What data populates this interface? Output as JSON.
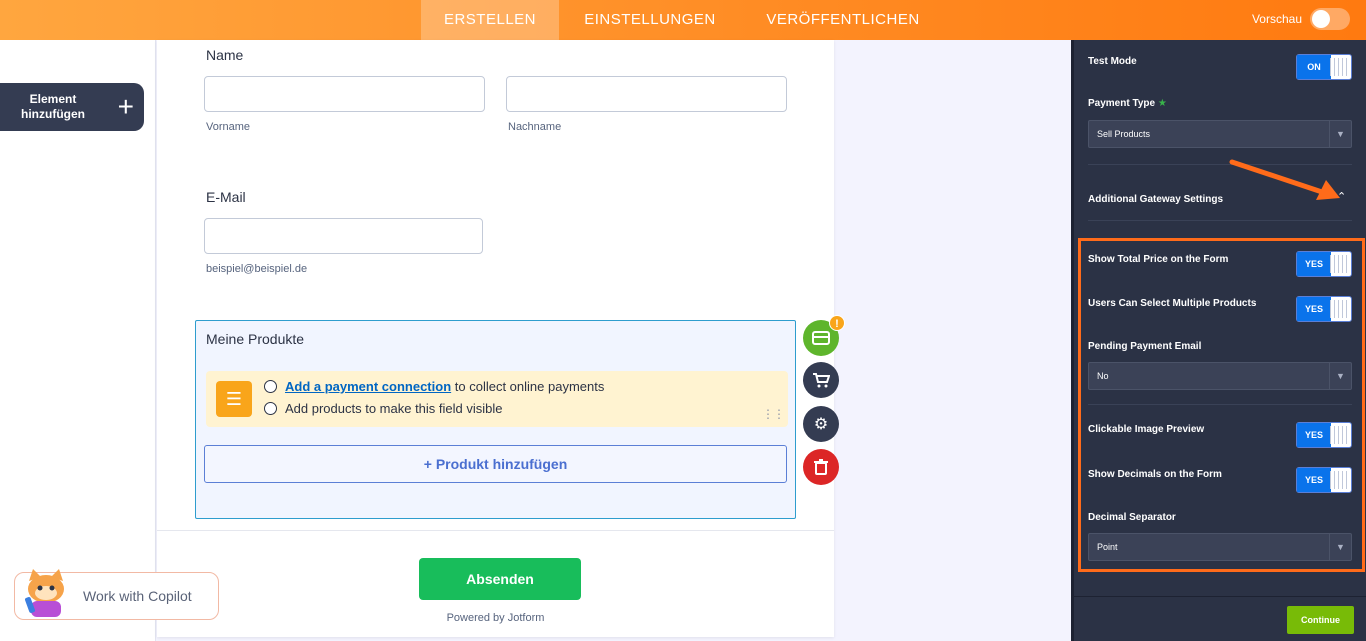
{
  "topbar": {
    "tabs": [
      {
        "label": "ERSTELLEN",
        "active": true
      },
      {
        "label": "EINSTELLUNGEN",
        "active": false
      },
      {
        "label": "VERÖFFENTLICHEN",
        "active": false
      }
    ],
    "preview_label": "Vorschau",
    "preview_on": false
  },
  "sidebar": {
    "add_element_label": "Element hinzufügen"
  },
  "form": {
    "name_label": "Name",
    "first_sublabel": "Vorname",
    "last_sublabel": "Nachname",
    "email_label": "E-Mail",
    "email_sublabel": "beispiel@beispiel.de",
    "products": {
      "title": "Meine Produkte",
      "notice_link": "Add a payment connection",
      "notice_rest": "to collect online payments",
      "notice_line2": "Add products to make this field visible",
      "add_product_label": "+ Produkt hinzufügen",
      "badge": "!"
    },
    "submit_label": "Absenden",
    "powered_by": "Powered by Jotform"
  },
  "copilot": {
    "label": "Work with Copilot"
  },
  "panel": {
    "test_mode_label": "Test Mode",
    "test_mode_value": "ON",
    "payment_type_label": "Payment Type",
    "payment_type_value": "Sell Products",
    "additional_label": "Additional Gateway Settings",
    "show_total_label": "Show Total Price on the Form",
    "show_total_value": "YES",
    "multi_products_label": "Users Can Select Multiple Products",
    "multi_products_value": "YES",
    "pending_email_label": "Pending Payment Email",
    "pending_email_value": "No",
    "image_preview_label": "Clickable Image Preview",
    "image_preview_value": "YES",
    "decimals_label": "Show Decimals on the Form",
    "decimals_value": "YES",
    "decimal_sep_label": "Decimal Separator",
    "decimal_sep_value": "Point",
    "continue_label": "Continue"
  },
  "colors": {
    "accent_orange": "#ff7a10",
    "toggle_blue": "#0a73eb",
    "submit_green": "#18bd5b",
    "continue_green": "#78bb07",
    "panel_bg": "#2b3245"
  }
}
